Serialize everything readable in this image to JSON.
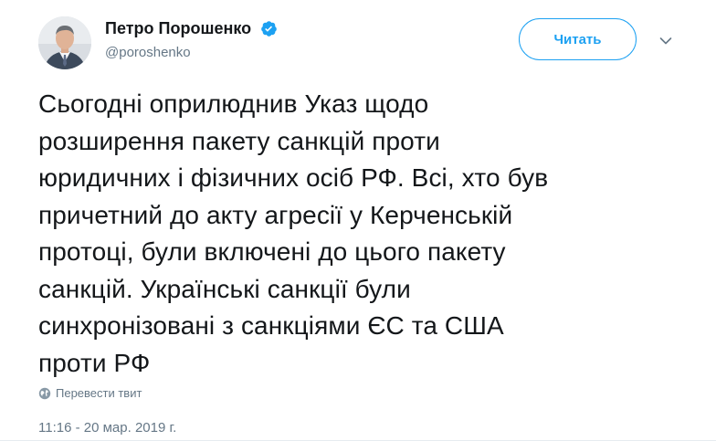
{
  "author": {
    "display_name": "Петро Порошенко",
    "handle": "@poroshenko",
    "verified": true,
    "verified_icon": "verified-badge-icon"
  },
  "follow_button": {
    "label": "Читать"
  },
  "menu": {
    "icon": "chevron-down-icon"
  },
  "tweet": {
    "text": "Сьогодні оприлюднив Указ щодо\nрозширення пакету санкцій проти\nюридичних і фізичних осіб РФ. Всі, хто був\nпричетний до акту агресії у Керченській\nпротоці, були включені до цього пакету\nсанкцій. Українські санкції були\nсинхронізовані з санкціями ЄС та США\nпроти РФ",
    "translate_label": "Перевести твит",
    "translate_icon": "globe-icon",
    "timestamp": "11:16 - 20 мар. 2019 г."
  },
  "colors": {
    "accent": "#1da1f2",
    "text": "#14171a",
    "secondary_text": "#657786"
  }
}
